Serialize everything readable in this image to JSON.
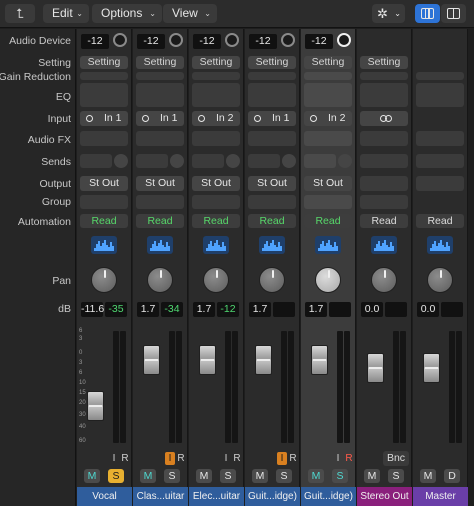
{
  "toolbar": {
    "back_icon": "arrow-back-icon",
    "edit_label": "Edit",
    "options_label": "Options",
    "view_label": "View",
    "gear_icon": "gear-icon"
  },
  "row_labels": {
    "audio_device": "Audio Device",
    "setting": "Setting",
    "gain_reduction": "Gain Reduction",
    "eq": "EQ",
    "input": "Input",
    "audio_fx": "Audio FX",
    "sends": "Sends",
    "output": "Output",
    "group": "Group",
    "automation": "Automation",
    "pan": "Pan",
    "db": "dB"
  },
  "channels": [
    {
      "name": "Vocal",
      "gain": "-12",
      "setting": "Setting",
      "input": "In 1",
      "output": "St Out",
      "automation": "Read",
      "db_left": "-11.6",
      "db_right": "-35",
      "solo_on": true,
      "input_monitor": false,
      "record": false,
      "color": "#2f5d9c"
    },
    {
      "name": "Clas...uitar",
      "gain": "-12",
      "setting": "Setting",
      "input": "In 1",
      "output": "St Out",
      "automation": "Read",
      "db_left": "1.7",
      "db_right": "-34",
      "solo_on": false,
      "input_monitor": true,
      "record": false,
      "color": "#2f5d9c"
    },
    {
      "name": "Elec...uitar",
      "gain": "-12",
      "setting": "Setting",
      "input": "In 2",
      "output": "St Out",
      "automation": "Read",
      "db_left": "1.7",
      "db_right": "-12",
      "solo_on": false,
      "input_monitor": false,
      "record": false,
      "color": "#2f5d9c"
    },
    {
      "name": "Guit...idge)",
      "gain": "-12",
      "setting": "Setting",
      "input": "In 1",
      "output": "St Out",
      "automation": "Read",
      "db_left": "1.7",
      "db_right": "",
      "solo_on": false,
      "input_monitor": true,
      "record": false,
      "color": "#2f5d9c"
    },
    {
      "name": "Guit...idge)",
      "gain": "-12",
      "setting": "Setting",
      "input": "In 2",
      "output": "St Out",
      "automation": "Read",
      "db_left": "1.7",
      "db_right": "",
      "solo_on": false,
      "input_monitor": false,
      "record": true,
      "color": "#2f5d9c"
    },
    {
      "name": "Stereo Out",
      "setting": "Setting",
      "automation": "Read",
      "db_left": "0.0",
      "bounce": "Bnc",
      "color": "#8a1f7c"
    },
    {
      "name": "Master",
      "automation": "Read",
      "db_left": "0.0",
      "color": "#6a3ea8"
    }
  ],
  "fader_scale": [
    "6",
    "3",
    "0",
    "3",
    "6",
    "10",
    "15",
    "20",
    "30",
    "40",
    "60"
  ],
  "fader_levels_db": [
    -11.6,
    1.7,
    1.7,
    1.7,
    1.7,
    0.0,
    0.0
  ],
  "button_labels": {
    "mute": "M",
    "solo": "S",
    "input": "I",
    "record": "R"
  }
}
